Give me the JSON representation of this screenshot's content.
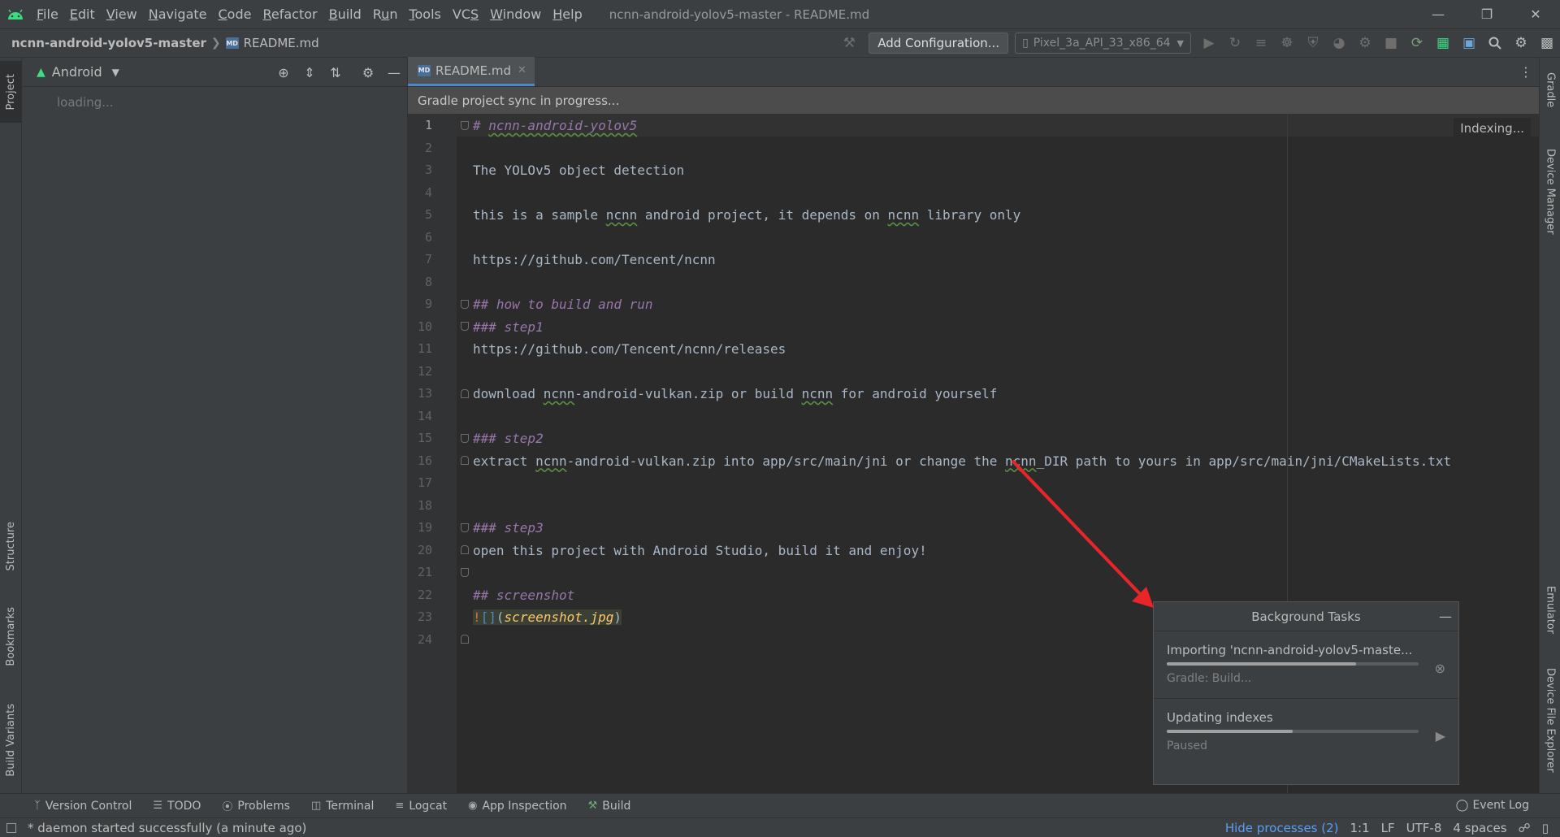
{
  "menubar": {
    "items": [
      "File",
      "Edit",
      "View",
      "Navigate",
      "Code",
      "Refactor",
      "Build",
      "Run",
      "Tools",
      "VCS",
      "Window",
      "Help"
    ],
    "underline": [
      "F",
      "E",
      "V",
      "N",
      "C",
      "R",
      "B",
      "u",
      "T",
      "S",
      "W",
      "H"
    ],
    "window_title": "ncnn-android-yolov5-master - README.md"
  },
  "navbar": {
    "project": "ncnn-android-yolov5-master",
    "file": "README.md",
    "add_configuration": "Add Configuration...",
    "device": "Pixel_3a_API_33_x86_64"
  },
  "left_stripe": {
    "project": "Project",
    "structure": "Structure",
    "bookmarks": "Bookmarks",
    "build_variants": "Build Variants"
  },
  "right_stripe": {
    "gradle": "Gradle",
    "device_manager": "Device Manager",
    "emulator": "Emulator",
    "device_file_explorer": "Device File Explorer"
  },
  "project_panel": {
    "view": "Android",
    "loading": "loading..."
  },
  "editor": {
    "tab": "README.md",
    "banner": "Gradle project sync in progress...",
    "indexing": "Indexing...",
    "current_line": 1,
    "line_numbers": [
      "1",
      "2",
      "3",
      "4",
      "5",
      "6",
      "7",
      "8",
      "9",
      "10",
      "11",
      "12",
      "13",
      "14",
      "15",
      "16",
      "17",
      "18",
      "19",
      "20",
      "21",
      "22",
      "23",
      "24"
    ]
  },
  "background_tasks": {
    "title": "Background Tasks",
    "tasks": [
      {
        "name": "Importing 'ncnn-android-yolov5-maste...",
        "status": "Gradle: Build...",
        "progress": 0.75
      },
      {
        "name": "Updating indexes",
        "status": "Paused",
        "progress": 0.5
      }
    ]
  },
  "bottom_tools": {
    "items": [
      "Version Control",
      "TODO",
      "Problems",
      "Terminal",
      "Logcat",
      "App Inspection",
      "Build"
    ],
    "event_log": "Event Log"
  },
  "statusbar": {
    "message": "* daemon started successfully (a minute ago)",
    "hide_processes": "Hide processes (2)",
    "position": "1:1",
    "line_sep": "LF",
    "encoding": "UTF-8",
    "indent": "4 spaces"
  },
  "colors": {
    "annotation_arrow": "#e8262a",
    "accent": "#4a88c7",
    "heading": "#9876aa"
  }
}
